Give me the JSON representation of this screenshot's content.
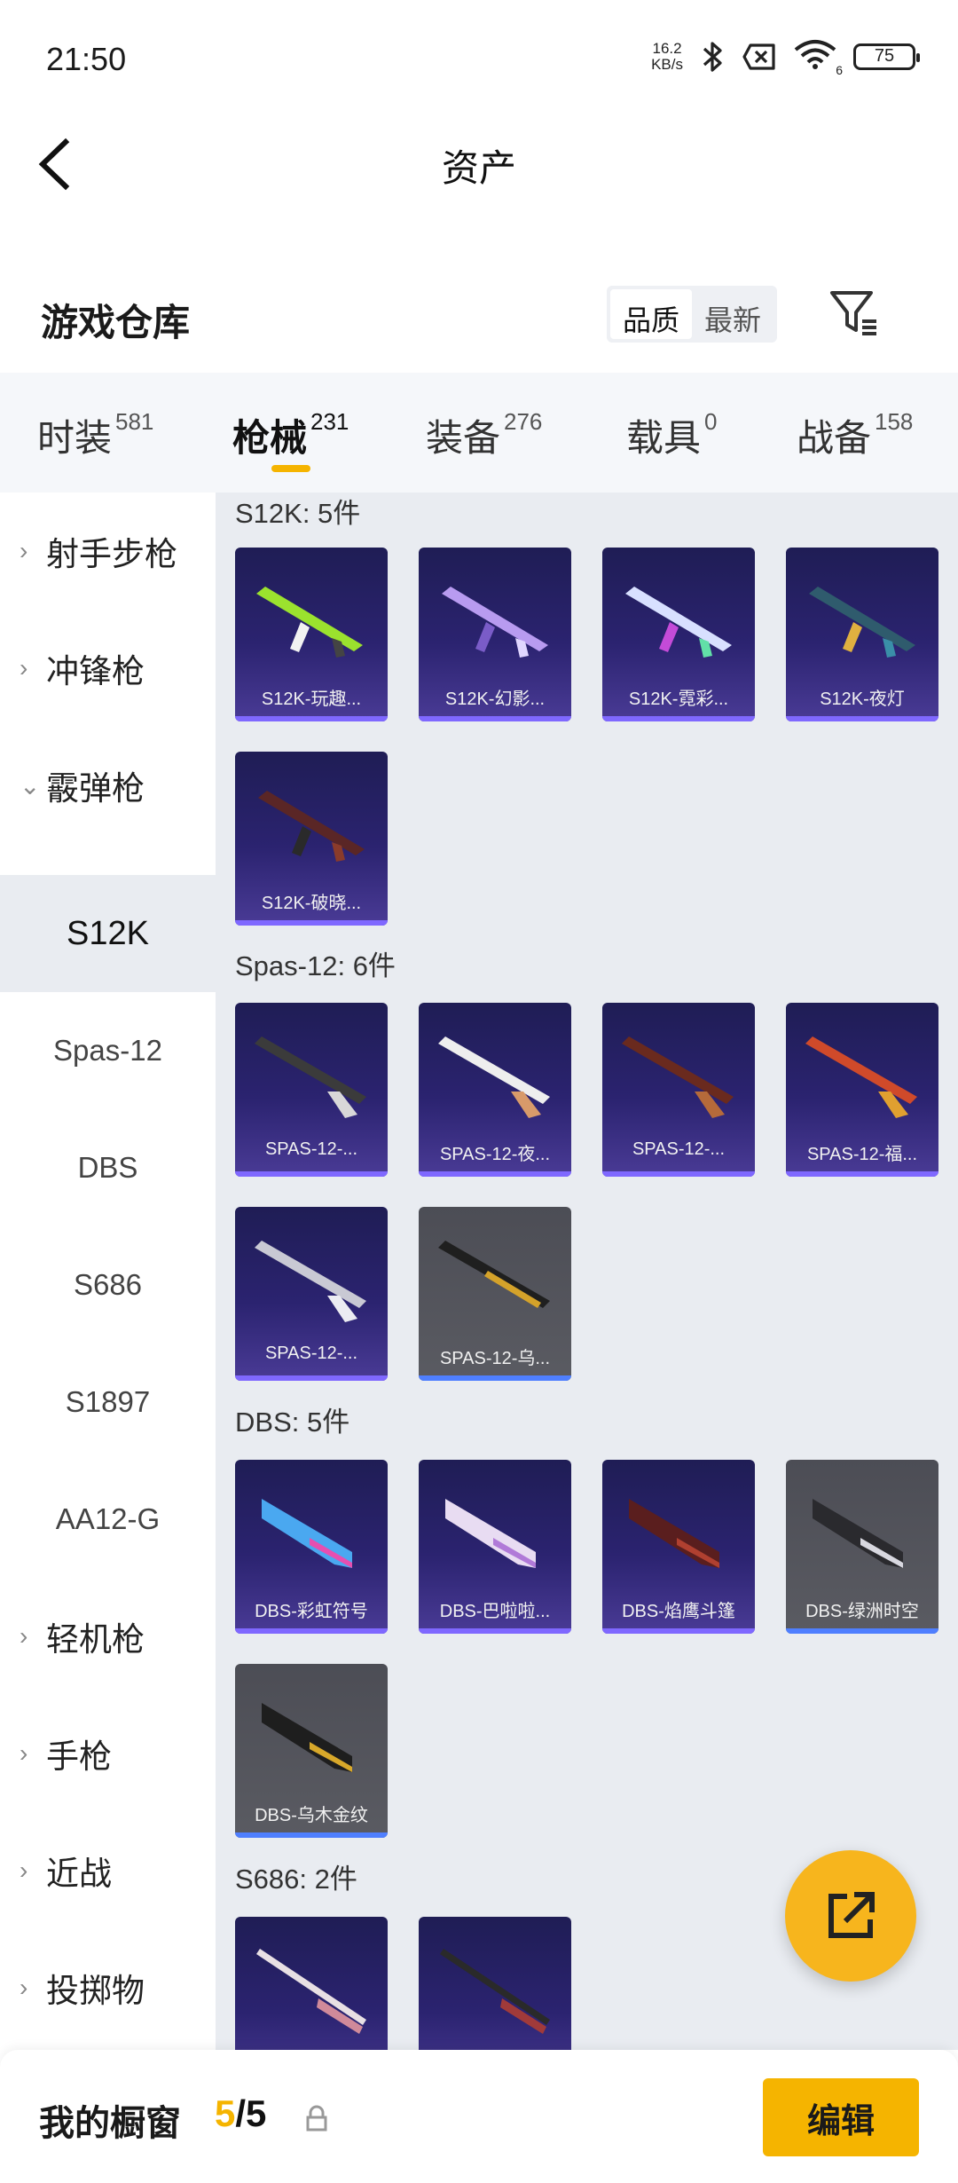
{
  "status_bar": {
    "time": "21:50",
    "net_speed": "16.2",
    "net_unit": "KB/s",
    "wifi_badge": "6",
    "battery": "75"
  },
  "header": {
    "title": "资产"
  },
  "section": {
    "title": "游戏仓库",
    "sort_options": [
      "品质",
      "最新"
    ],
    "sort_selected": "品质"
  },
  "tabs": [
    {
      "label": "时装",
      "count": "581"
    },
    {
      "label": "枪械",
      "count": "231"
    },
    {
      "label": "装备",
      "count": "276"
    },
    {
      "label": "载具",
      "count": "0"
    },
    {
      "label": "战备",
      "count": "158"
    }
  ],
  "sidebar": {
    "items": [
      {
        "label": "射手步枪"
      },
      {
        "label": "冲锋枪"
      },
      {
        "label": "霰弹枪"
      },
      {
        "label": "S12K"
      },
      {
        "label": "Spas-12"
      },
      {
        "label": "DBS"
      },
      {
        "label": "S686"
      },
      {
        "label": "S1897"
      },
      {
        "label": "AA12-G"
      },
      {
        "label": "轻机枪"
      },
      {
        "label": "手枪"
      },
      {
        "label": "近战"
      },
      {
        "label": "投掷物"
      }
    ]
  },
  "groups": [
    {
      "title": "S12K: 5件",
      "items": [
        "S12K-玩趣...",
        "S12K-幻影...",
        "S12K-霓彩...",
        "S12K-夜灯",
        "S12K-破晓..."
      ]
    },
    {
      "title": "Spas-12: 6件",
      "items": [
        "SPAS-12-...",
        "SPAS-12-夜...",
        "SPAS-12-...",
        "SPAS-12-福...",
        "SPAS-12-...",
        "SPAS-12-乌..."
      ]
    },
    {
      "title": "DBS: 5件",
      "items": [
        "DBS-彩虹符号",
        "DBS-巴啦啦...",
        "DBS-焰鹰斗篷",
        "DBS-绿洲时空",
        "DBS-乌木金纹"
      ]
    },
    {
      "title": "S686: 2件",
      "items": [
        "",
        ""
      ]
    }
  ],
  "bottom_bar": {
    "showcase_label": "我的橱窗",
    "current": "5",
    "total": "/5",
    "edit_label": "编辑"
  },
  "colors": {
    "accent": "#f5b400",
    "card_purple": "#2b2370",
    "card_grey": "#55565d"
  }
}
